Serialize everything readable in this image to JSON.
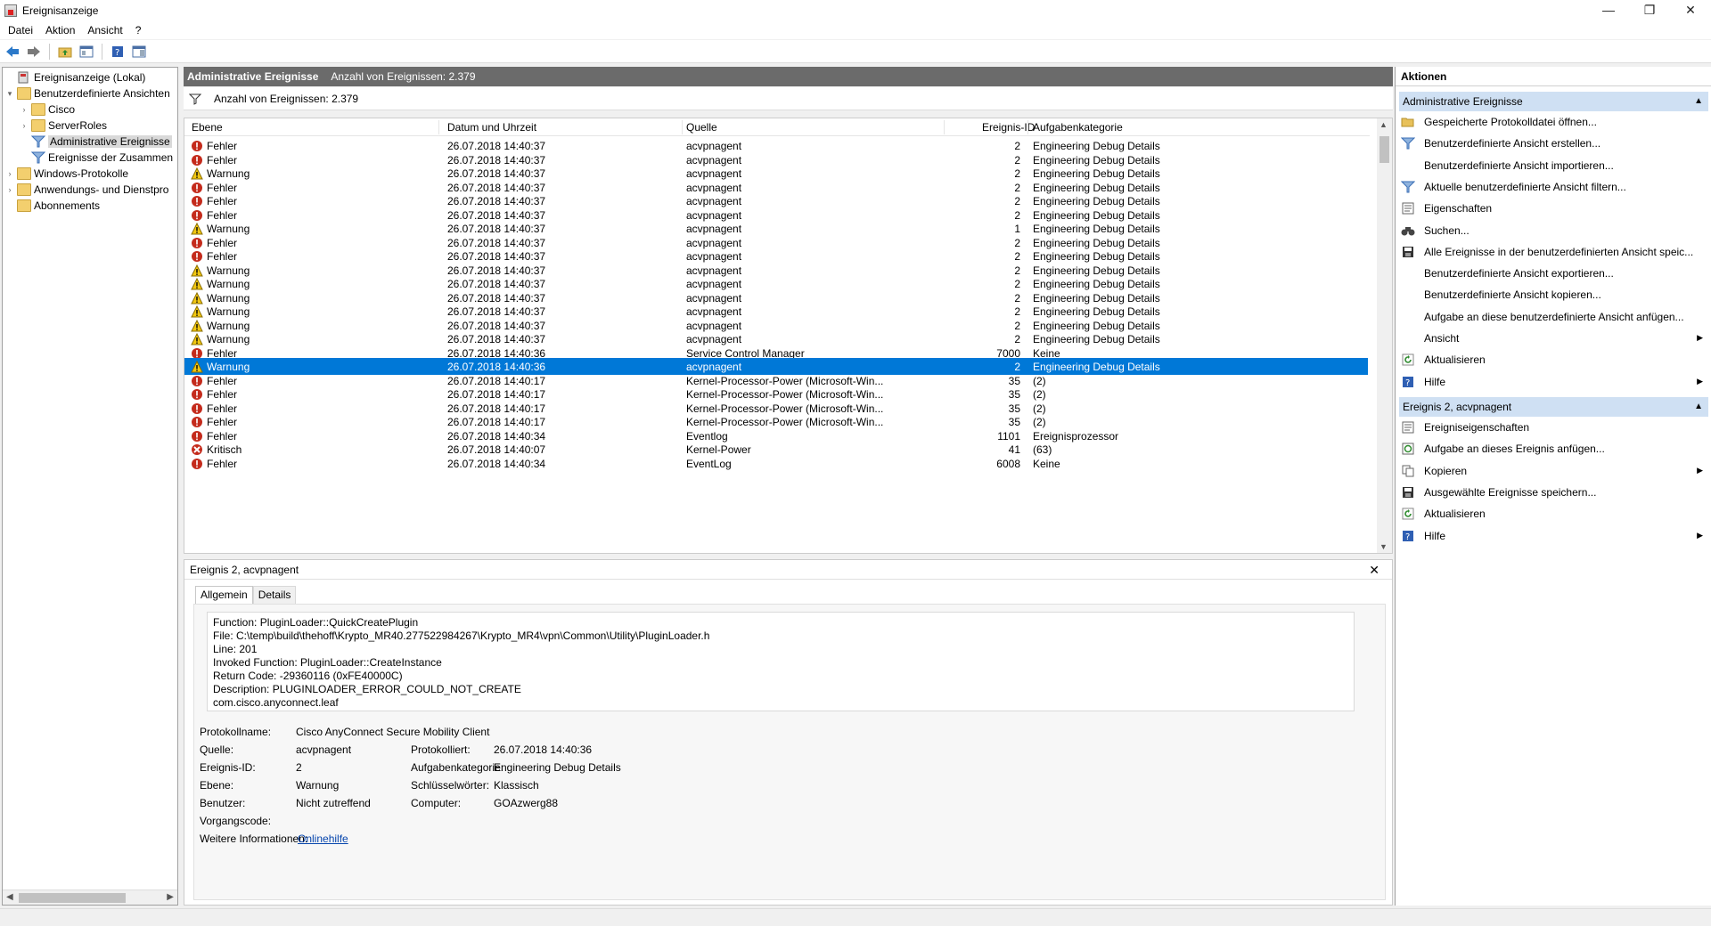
{
  "window": {
    "title": "Ereignisanzeige"
  },
  "menu": [
    "Datei",
    "Aktion",
    "Ansicht",
    "?"
  ],
  "tree": [
    {
      "label": "Ereignisanzeige (Lokal)",
      "level": 0,
      "expander": "",
      "icon": "computer"
    },
    {
      "label": "Benutzerdefinierte Ansichten",
      "level": 0,
      "expander": "▾",
      "icon": "folder"
    },
    {
      "label": "Cisco",
      "level": 1,
      "expander": "›",
      "icon": "folder"
    },
    {
      "label": "ServerRoles",
      "level": 1,
      "expander": "›",
      "icon": "folder"
    },
    {
      "label": "Administrative Ereignisse",
      "level": 1,
      "expander": "",
      "icon": "filter",
      "selected": true
    },
    {
      "label": "Ereignisse der Zusammen",
      "level": 1,
      "expander": "",
      "icon": "filter"
    },
    {
      "label": "Windows-Protokolle",
      "level": 0,
      "expander": "›",
      "icon": "folder"
    },
    {
      "label": "Anwendungs- und Dienstpro",
      "level": 0,
      "expander": "›",
      "icon": "folder"
    },
    {
      "label": "Abonnements",
      "level": 0,
      "expander": "",
      "icon": "folder"
    }
  ],
  "middle": {
    "header_title": "Administrative Ereignisse",
    "header_count": "Anzahl von Ereignissen: 2.379",
    "filter_text": "Anzahl von Ereignissen: 2.379",
    "columns": [
      "Ebene",
      "Datum und Uhrzeit",
      "Quelle",
      "Ereignis-ID",
      "Aufgabenkategorie"
    ],
    "rows": [
      {
        "level": "Fehler",
        "date": "26.07.2018 14:40:37",
        "source": "acvpnagent",
        "id": "2",
        "task": "Engineering Debug Details"
      },
      {
        "level": "Fehler",
        "date": "26.07.2018 14:40:37",
        "source": "acvpnagent",
        "id": "2",
        "task": "Engineering Debug Details"
      },
      {
        "level": "Warnung",
        "date": "26.07.2018 14:40:37",
        "source": "acvpnagent",
        "id": "2",
        "task": "Engineering Debug Details"
      },
      {
        "level": "Fehler",
        "date": "26.07.2018 14:40:37",
        "source": "acvpnagent",
        "id": "2",
        "task": "Engineering Debug Details"
      },
      {
        "level": "Fehler",
        "date": "26.07.2018 14:40:37",
        "source": "acvpnagent",
        "id": "2",
        "task": "Engineering Debug Details"
      },
      {
        "level": "Fehler",
        "date": "26.07.2018 14:40:37",
        "source": "acvpnagent",
        "id": "2",
        "task": "Engineering Debug Details"
      },
      {
        "level": "Warnung",
        "date": "26.07.2018 14:40:37",
        "source": "acvpnagent",
        "id": "1",
        "task": "Engineering Debug Details"
      },
      {
        "level": "Fehler",
        "date": "26.07.2018 14:40:37",
        "source": "acvpnagent",
        "id": "2",
        "task": "Engineering Debug Details"
      },
      {
        "level": "Fehler",
        "date": "26.07.2018 14:40:37",
        "source": "acvpnagent",
        "id": "2",
        "task": "Engineering Debug Details"
      },
      {
        "level": "Warnung",
        "date": "26.07.2018 14:40:37",
        "source": "acvpnagent",
        "id": "2",
        "task": "Engineering Debug Details"
      },
      {
        "level": "Warnung",
        "date": "26.07.2018 14:40:37",
        "source": "acvpnagent",
        "id": "2",
        "task": "Engineering Debug Details"
      },
      {
        "level": "Warnung",
        "date": "26.07.2018 14:40:37",
        "source": "acvpnagent",
        "id": "2",
        "task": "Engineering Debug Details"
      },
      {
        "level": "Warnung",
        "date": "26.07.2018 14:40:37",
        "source": "acvpnagent",
        "id": "2",
        "task": "Engineering Debug Details"
      },
      {
        "level": "Warnung",
        "date": "26.07.2018 14:40:37",
        "source": "acvpnagent",
        "id": "2",
        "task": "Engineering Debug Details"
      },
      {
        "level": "Warnung",
        "date": "26.07.2018 14:40:37",
        "source": "acvpnagent",
        "id": "2",
        "task": "Engineering Debug Details"
      },
      {
        "level": "Fehler",
        "date": "26.07.2018 14:40:36",
        "source": "Service Control Manager",
        "id": "7000",
        "task": "Keine"
      },
      {
        "level": "Warnung",
        "date": "26.07.2018 14:40:36",
        "source": "acvpnagent",
        "id": "2",
        "task": "Engineering Debug Details",
        "selected": true
      },
      {
        "level": "Fehler",
        "date": "26.07.2018 14:40:17",
        "source": "Kernel-Processor-Power (Microsoft-Win...",
        "id": "35",
        "task": "(2)"
      },
      {
        "level": "Fehler",
        "date": "26.07.2018 14:40:17",
        "source": "Kernel-Processor-Power (Microsoft-Win...",
        "id": "35",
        "task": "(2)"
      },
      {
        "level": "Fehler",
        "date": "26.07.2018 14:40:17",
        "source": "Kernel-Processor-Power (Microsoft-Win...",
        "id": "35",
        "task": "(2)"
      },
      {
        "level": "Fehler",
        "date": "26.07.2018 14:40:17",
        "source": "Kernel-Processor-Power (Microsoft-Win...",
        "id": "35",
        "task": "(2)"
      },
      {
        "level": "Fehler",
        "date": "26.07.2018 14:40:34",
        "source": "Eventlog",
        "id": "1101",
        "task": "Ereignisprozessor"
      },
      {
        "level": "Kritisch",
        "date": "26.07.2018 14:40:07",
        "source": "Kernel-Power",
        "id": "41",
        "task": "(63)"
      },
      {
        "level": "Fehler",
        "date": "26.07.2018 14:40:34",
        "source": "EventLog",
        "id": "6008",
        "task": "Keine"
      }
    ]
  },
  "detail": {
    "title": "Ereignis 2, acvpnagent",
    "tabs": [
      "Allgemein",
      "Details"
    ],
    "description": "Function: PluginLoader::QuickCreatePlugin\nFile: C:\\temp\\build\\thehoff\\Krypto_MR40.277522984267\\Krypto_MR4\\vpn\\Common\\Utility\\PluginLoader.h\nLine: 201\nInvoked Function: PluginLoader::CreateInstance\nReturn Code: -29360116 (0xFE40000C)\nDescription: PLUGINLOADER_ERROR_COULD_NOT_CREATE\ncom.cisco.anyconnect.leaf",
    "log_name_label": "Protokollname:",
    "log_name": "Cisco AnyConnect Secure Mobility Client",
    "source_label": "Quelle:",
    "source": "acvpnagent",
    "logged_label": "Protokolliert:",
    "logged": "26.07.2018 14:40:36",
    "event_id_label": "Ereignis-ID:",
    "event_id": "2",
    "task_label": "Aufgabenkategorie:",
    "task": "Engineering Debug Details",
    "level_label": "Ebene:",
    "level": "Warnung",
    "keywords_label": "Schlüsselwörter:",
    "keywords": "Klassisch",
    "user_label": "Benutzer:",
    "user": "Nicht zutreffend",
    "computer_label": "Computer:",
    "computer": "GOAzwerg88",
    "opcode_label": "Vorgangscode:",
    "moreinfo_label": "Weitere Informationen:",
    "moreinfo_link": "Onlinehilfe"
  },
  "actions": {
    "title": "Aktionen",
    "section1": "Administrative Ereignisse",
    "items1": [
      {
        "label": "Gespeicherte Protokolldatei öffnen...",
        "icon": "folder-open-icon"
      },
      {
        "label": "Benutzerdefinierte Ansicht erstellen...",
        "icon": "filter-icon"
      },
      {
        "label": "Benutzerdefinierte Ansicht importieren...",
        "icon": ""
      },
      {
        "label": "Aktuelle benutzerdefinierte Ansicht filtern...",
        "icon": "filter-icon"
      },
      {
        "label": "Eigenschaften",
        "icon": "properties-icon"
      },
      {
        "label": "Suchen...",
        "icon": "binoculars-icon"
      },
      {
        "label": "Alle Ereignisse in der benutzerdefinierten Ansicht speic...",
        "icon": "save-icon"
      },
      {
        "label": "Benutzerdefinierte Ansicht exportieren...",
        "icon": ""
      },
      {
        "label": "Benutzerdefinierte Ansicht kopieren...",
        "icon": ""
      },
      {
        "label": "Aufgabe an diese benutzerdefinierte Ansicht anfügen...",
        "icon": ""
      },
      {
        "label": "Ansicht",
        "icon": "",
        "submenu": true
      },
      {
        "label": "Aktualisieren",
        "icon": "refresh-icon"
      },
      {
        "label": "Hilfe",
        "icon": "help-icon",
        "submenu": true
      }
    ],
    "section2": "Ereignis 2, acvpnagent",
    "items2": [
      {
        "label": "Ereigniseigenschaften",
        "icon": "properties-icon"
      },
      {
        "label": "Aufgabe an dieses Ereignis anfügen...",
        "icon": "task-icon"
      },
      {
        "label": "Kopieren",
        "icon": "copy-icon",
        "submenu": true
      },
      {
        "label": "Ausgewählte Ereignisse speichern...",
        "icon": "save-icon"
      },
      {
        "label": "Aktualisieren",
        "icon": "refresh-icon"
      },
      {
        "label": "Hilfe",
        "icon": "help-icon",
        "submenu": true
      }
    ]
  },
  "colors": {
    "selection": "#0078d7",
    "section": "#cfe0f3",
    "header_bg": "#6b6b6b",
    "error": "#c42b1c",
    "warning": "#f2c811",
    "link": "#0645ad"
  }
}
